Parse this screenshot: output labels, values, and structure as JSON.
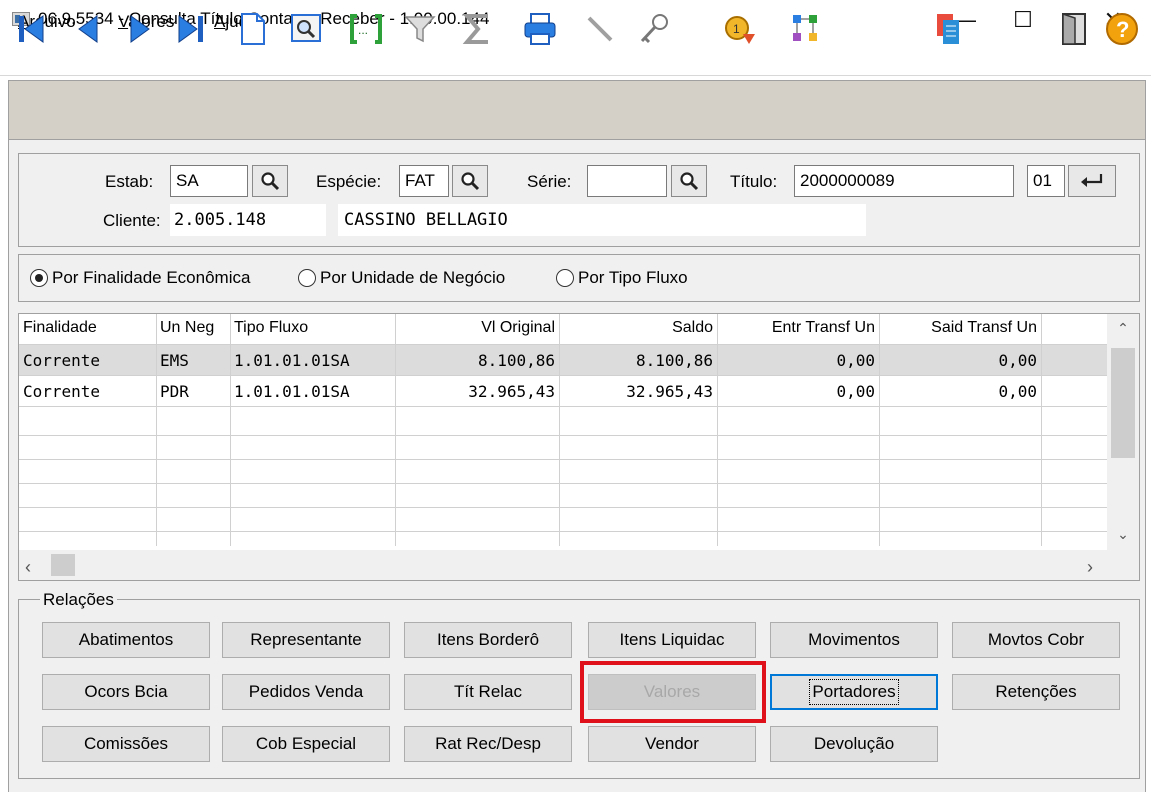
{
  "window": {
    "title": "06.9.5534 - Consulta Título Contas a Receber - 1.00.00.144",
    "minimize": "—",
    "maximize": "☐",
    "close": "✕"
  },
  "menu": [
    {
      "underline": "A",
      "rest": "rquivo"
    },
    {
      "underline": "V",
      "rest": "alores"
    },
    {
      "underline": "A",
      "rest": "juda"
    }
  ],
  "toolbar_icons": [
    "first-record-icon",
    "prev-record-icon",
    "next-record-icon",
    "last-record-icon",
    "new-document-icon",
    "zoom-search-icon",
    "goto-icon",
    "filter-icon",
    "sum-icon",
    "print-icon",
    "line-icon",
    "key-icon",
    "schedule-icon",
    "tree-icon",
    "report-icon",
    "exit-door-icon",
    "help-icon"
  ],
  "header": {
    "estab_label": "Estab:",
    "estab_value": "SA",
    "especie_label": "Espécie:",
    "especie_value": "FAT",
    "serie_label": "Série:",
    "serie_value": "",
    "titulo_label": "Título:",
    "titulo_value": "2000000089",
    "parcela_value": "01",
    "cliente_label": "Cliente:",
    "cliente_code": "2.005.148",
    "cliente_name": "CASSINO BELLAGIO"
  },
  "radios": [
    {
      "label": "Por Finalidade Econômica",
      "selected": true
    },
    {
      "label": "Por Unidade de Negócio",
      "selected": false
    },
    {
      "label": "Por Tipo Fluxo",
      "selected": false
    }
  ],
  "grid": {
    "columns": [
      "Finalidade",
      "Un Neg",
      "Tipo Fluxo",
      "Vl Original",
      "Saldo",
      "Entr Transf Un",
      "Said Transf Un"
    ],
    "rows": [
      [
        "Corrente",
        "EMS",
        "1.01.01.01SA",
        "8.100,86",
        "8.100,86",
        "0,00",
        "0,00"
      ],
      [
        "Corrente",
        "PDR",
        "1.01.01.01SA",
        "32.965,43",
        "32.965,43",
        "0,00",
        "0,00"
      ]
    ]
  },
  "relacoes": {
    "title": "Relações",
    "buttons": [
      [
        "Abatimentos",
        "Representante",
        "Itens Borderô",
        "Itens Liquidac",
        "Movimentos",
        "Movtos Cobr"
      ],
      [
        "Ocors Bcia",
        "Pedidos Venda",
        "Tít Relac",
        "Valores",
        "Portadores",
        "Retenções"
      ],
      [
        "Comissões",
        "Cob Especial",
        "Rat Rec/Desp",
        "Vendor",
        "Devolução"
      ]
    ]
  }
}
